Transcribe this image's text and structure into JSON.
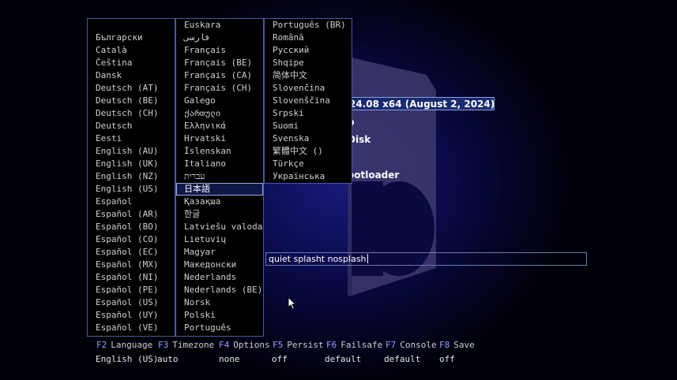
{
  "boot": {
    "title": "24.08 x64 (August 2, 2024)",
    "items": [
      "p",
      "Disk",
      "ootloader"
    ],
    "cmdline": "quiet splasht nosplash"
  },
  "languages": {
    "col1": [
      "Български",
      "Català",
      "Čeština",
      "Dansk",
      "Deutsch (AT)",
      "Deutsch (BE)",
      "Deutsch (CH)",
      "Deutsch",
      "Eesti",
      "English (AU)",
      "English (UK)",
      "English (NZ)",
      "English (US)",
      "Español",
      "Español (AR)",
      "Español (BO)",
      "Español (CO)",
      "Español (EC)",
      "Español (MX)",
      "Español (NI)",
      "Español (PE)",
      "Español (US)",
      "Español (UY)",
      "Español (VE)"
    ],
    "col2": [
      "Euskara",
      "فارسی",
      "Français",
      "Français (BE)",
      "Français (CA)",
      "Français (CH)",
      "Galego",
      "ქართული",
      "Ελληνικά",
      "Hrvatski",
      "Íslenskan",
      "Italiano",
      "עברית",
      "日本語",
      "Қазақша",
      "한글",
      "Latviešu valoda",
      "Lietuvių",
      "Magyar",
      "Македонски",
      "Nederlands",
      "Nederlands (BE)",
      "Norsk",
      "Polski",
      "Português"
    ],
    "col3": [
      "Português (BR)",
      "Română",
      "Русский",
      "Shqipe",
      "简体中文",
      "Slovenčina",
      "Slovenščina",
      "Srpski",
      "Suomi",
      "Svenska",
      "繁體中文 ()",
      "Türkçe",
      "Українська"
    ],
    "selected": "日本語"
  },
  "fkeys": [
    {
      "key": "F2",
      "label": "Language",
      "value": "English (US)"
    },
    {
      "key": "F3",
      "label": "Timezone",
      "value": "auto"
    },
    {
      "key": "F4",
      "label": "Options",
      "value": "none"
    },
    {
      "key": "F5",
      "label": "Persist",
      "value": "off"
    },
    {
      "key": "F6",
      "label": "Failsafe",
      "value": "default"
    },
    {
      "key": "F7",
      "label": "Console",
      "value": "default"
    },
    {
      "key": "F8",
      "label": "Save",
      "value": "off"
    }
  ],
  "colors": {
    "fkey": "#8aa4ff",
    "border": "#4a5a9a",
    "accent": "#182a70"
  }
}
